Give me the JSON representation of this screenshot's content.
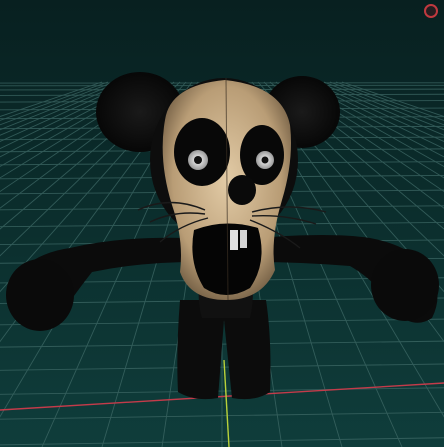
{
  "viewport": {
    "background_top": "#0b2a2a",
    "background_bottom": "#0e3b3a",
    "grid_color": "#3f6a67",
    "x_axis_color": "#c43b4a",
    "y_axis_color": "#b9d23a"
  },
  "model": {
    "name": "",
    "skin_color": "#0d0d0d",
    "face_color": "#c9b28f",
    "eye_white": "#e8e8e8"
  },
  "controls": {
    "close_icon": "close-icon",
    "close_color": "#c0393f"
  }
}
